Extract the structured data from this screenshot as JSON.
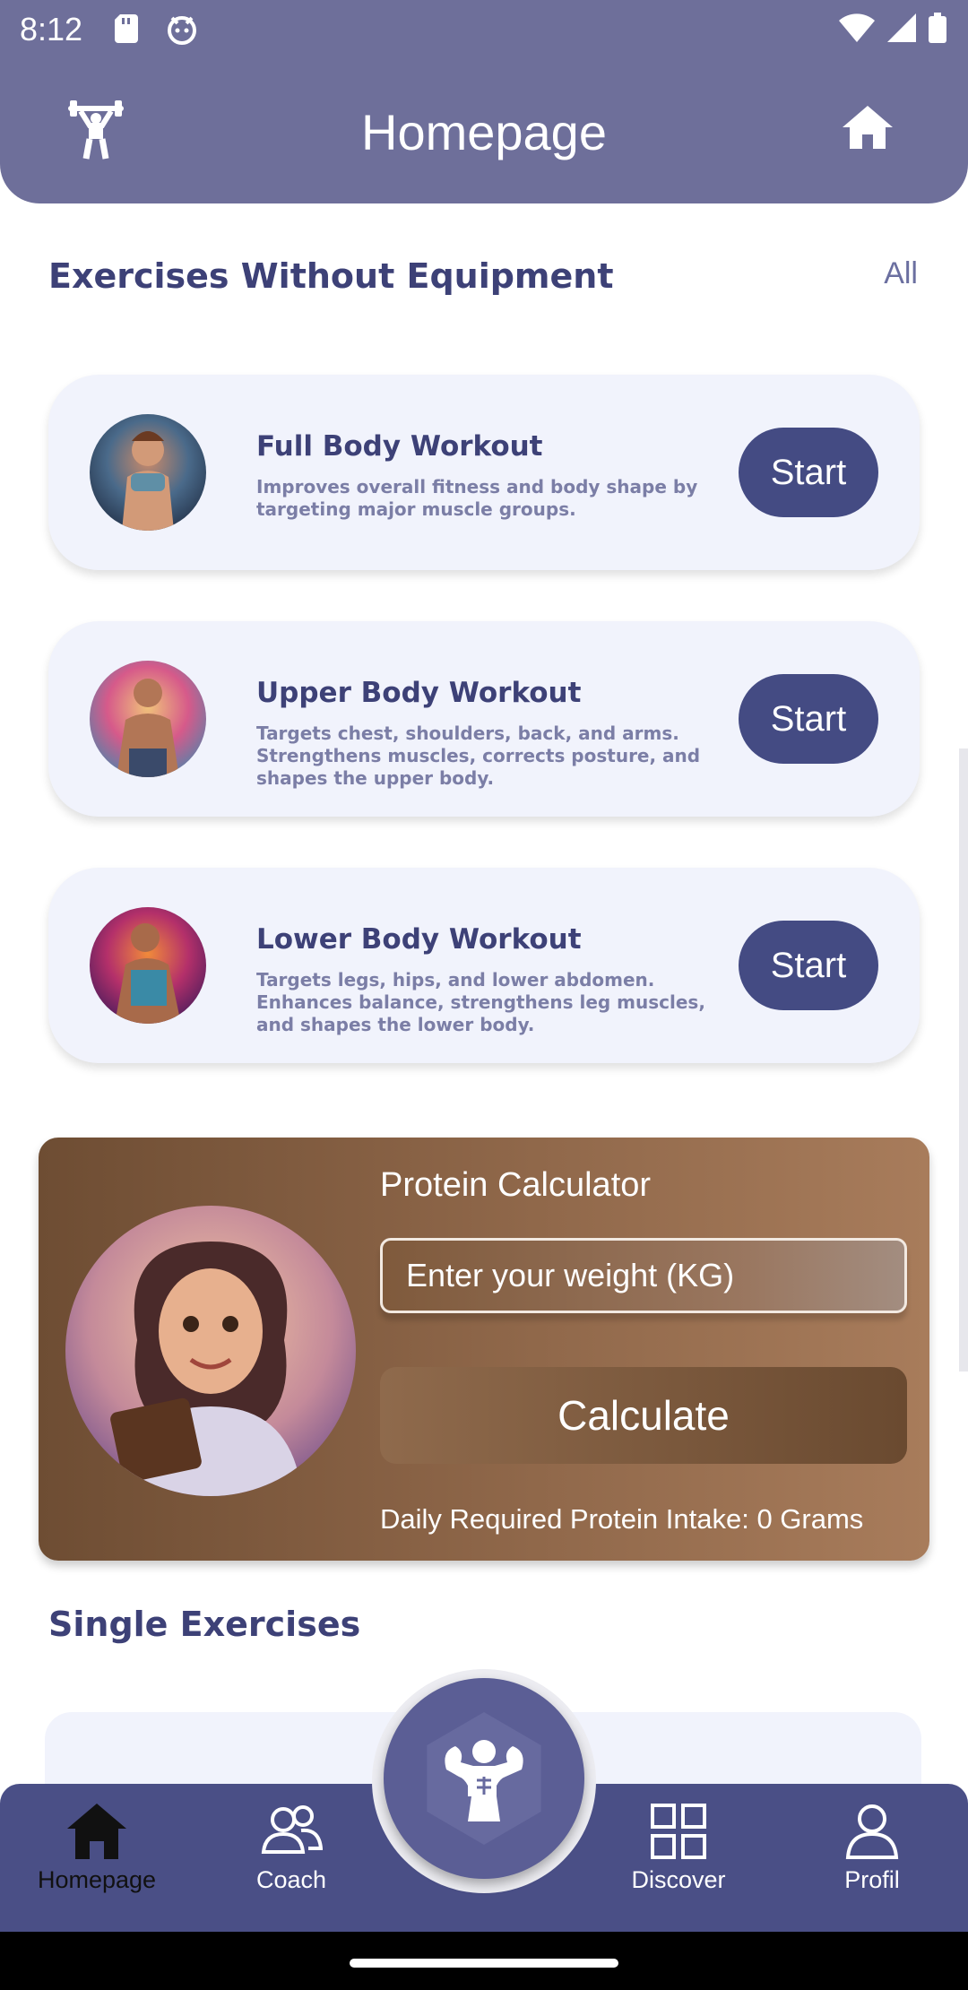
{
  "status_bar": {
    "time": "8:12"
  },
  "app_bar": {
    "title": "Homepage",
    "left_icon": "weightlifter-icon",
    "right_icon": "home-icon"
  },
  "sections": {
    "exercises_title": "Exercises Without Equipment",
    "all_link": "All",
    "single_title": "Single Exercises"
  },
  "workouts": [
    {
      "title": "Full Body Workout",
      "description": "Improves overall fitness and body shape by targeting major muscle groups.",
      "button": "Start"
    },
    {
      "title": "Upper Body Workout",
      "description": "Targets chest, shoulders, back, and arms. Strengthens muscles, corrects posture, and shapes the upper body.",
      "button": "Start"
    },
    {
      "title": "Lower Body Workout",
      "description": "Targets legs, hips, and lower abdomen. Enhances balance, strengthens leg muscles, and shapes the lower body.",
      "button": "Start"
    }
  ],
  "protein": {
    "title": "Protein Calculator",
    "weight_placeholder": "Enter your weight (KG)",
    "calculate_label": "Calculate",
    "result": "Daily Required Protein Intake: 0 Grams"
  },
  "bottom_nav": {
    "items": [
      {
        "label": "Homepage",
        "icon": "home-icon",
        "active": true
      },
      {
        "label": "Coach",
        "icon": "users-icon",
        "active": false
      },
      {
        "label": "Discover",
        "icon": "grid-icon",
        "active": false
      },
      {
        "label": "Profil",
        "icon": "user-icon",
        "active": false
      }
    ],
    "center_icon": "bodybuilder-icon"
  },
  "colors": {
    "primary": "#444b83",
    "appbar": "#6e6f9a",
    "card_bg": "#f1f3fc",
    "protein_brown": "#8a6346"
  }
}
